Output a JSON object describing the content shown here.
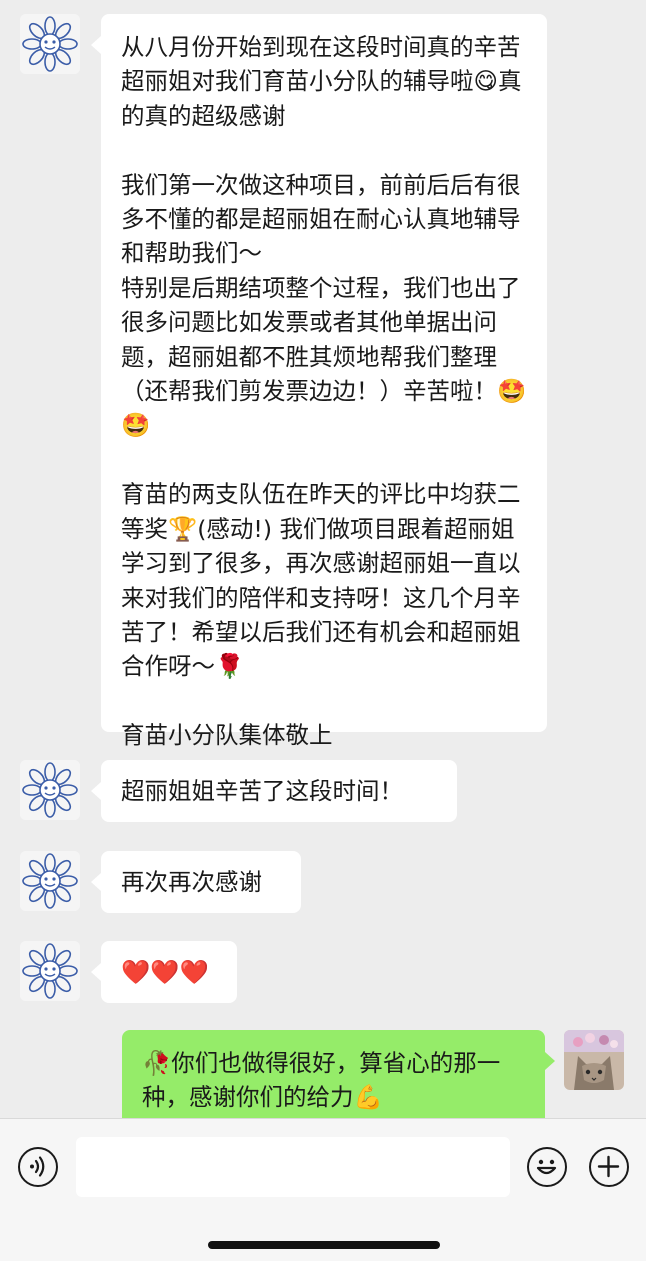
{
  "messages": [
    {
      "sender": "contact",
      "text": "从八月份开始到现在这段时间真的辛苦超丽姐对我们育苗小分队的辅导啦😋真的真的超级感谢\n\n我们第一次做这种项目，前前后后有很多不懂的都是超丽姐在耐心认真地辅导和帮助我们～\n特别是后期结项整个过程，我们也出了很多问题比如发票或者其他单据出问题，超丽姐都不胜其烦地帮我们整理（还帮我们剪发票边边！）辛苦啦！🤩🤩\n\n育苗的两支队伍在昨天的评比中均获二等奖🏆(感动!) 我们做项目跟着超丽姐学习到了很多，再次感谢超丽姐一直以来对我们的陪伴和支持呀！这几个月辛苦了！希望以后我们还有机会和超丽姐合作呀～🌹\n\n育苗小分队集体敬上"
    },
    {
      "sender": "contact",
      "text": "超丽姐姐辛苦了这段时间！"
    },
    {
      "sender": "contact",
      "text": "再次再次感谢"
    },
    {
      "sender": "contact",
      "text": "❤️❤️❤️"
    },
    {
      "sender": "self",
      "text": "🥀你们也做得很好，算省心的那一种，感谢你们的给力💪"
    }
  ],
  "toolbar": {
    "voice_icon": "voice-icon",
    "emoji_icon": "emoji-icon",
    "plus_icon": "plus-icon",
    "input_value": ""
  },
  "colors": {
    "background": "#ededed",
    "incoming_bubble": "#ffffff",
    "outgoing_bubble": "#95ec69"
  }
}
